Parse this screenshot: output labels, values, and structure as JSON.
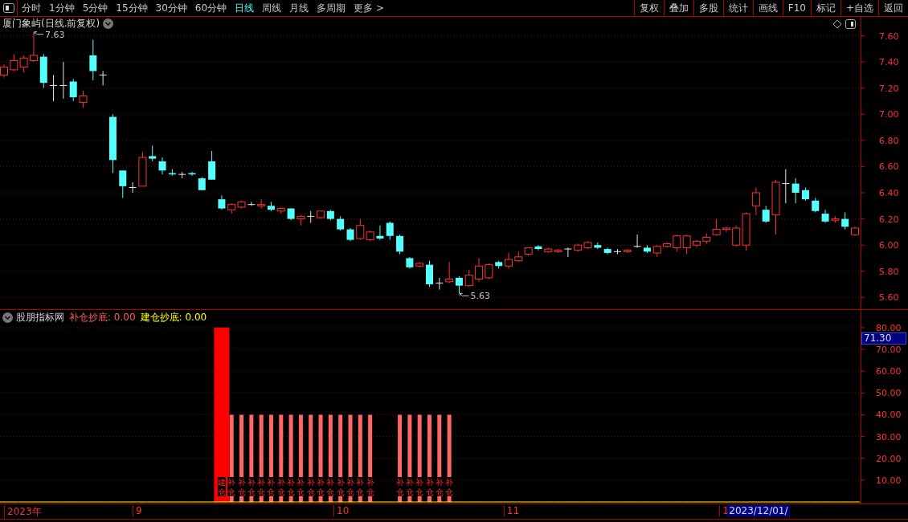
{
  "toolbar": {
    "periods": [
      {
        "label": "分时",
        "selected": false
      },
      {
        "label": "1分钟",
        "selected": false
      },
      {
        "label": "5分钟",
        "selected": false
      },
      {
        "label": "15分钟",
        "selected": false
      },
      {
        "label": "30分钟",
        "selected": false
      },
      {
        "label": "60分钟",
        "selected": false
      },
      {
        "label": "日线",
        "selected": true
      },
      {
        "label": "周线",
        "selected": false
      },
      {
        "label": "月线",
        "selected": false
      },
      {
        "label": "多周期",
        "selected": false
      },
      {
        "label": "更多 >",
        "selected": false
      }
    ],
    "buttons": [
      "复权",
      "叠加",
      "多股",
      "统计",
      "画线",
      "F10",
      "标记",
      "+自选",
      "返回"
    ]
  },
  "main_chart": {
    "title": "厦门象屿(日线.前复权)",
    "chart_data": {
      "type": "candlestick",
      "ylim": [
        5.51,
        7.64
      ],
      "grid": true,
      "yticks": [
        {
          "value": 5.6,
          "label": "5.60"
        },
        {
          "value": 5.8,
          "label": "5.80"
        },
        {
          "value": 6.0,
          "label": "6.00"
        },
        {
          "value": 6.2,
          "label": "6.20"
        },
        {
          "value": 6.4,
          "label": "6.40"
        },
        {
          "value": 6.6,
          "label": "6.60"
        },
        {
          "value": 6.8,
          "label": "6.80"
        },
        {
          "value": 7.0,
          "label": "7.00"
        },
        {
          "value": 7.2,
          "label": "7.20"
        },
        {
          "value": 7.4,
          "label": "7.40"
        },
        {
          "value": 7.6,
          "label": "7.60"
        }
      ],
      "ohlc": [
        [
          7.3,
          7.38,
          7.28,
          7.36
        ],
        [
          7.34,
          7.46,
          7.33,
          7.41
        ],
        [
          7.36,
          7.45,
          7.32,
          7.43
        ],
        [
          7.41,
          7.63,
          7.4,
          7.45
        ],
        [
          7.44,
          7.46,
          7.2,
          7.24
        ],
        [
          7.22,
          7.3,
          7.1,
          7.22
        ],
        [
          7.22,
          7.4,
          7.12,
          7.22
        ],
        [
          7.25,
          7.27,
          7.1,
          7.13
        ],
        [
          7.09,
          7.18,
          7.05,
          7.14
        ],
        [
          7.45,
          7.57,
          7.26,
          7.33
        ],
        [
          7.3,
          7.33,
          7.22,
          7.3
        ],
        [
          6.98,
          7.0,
          6.55,
          6.65
        ],
        [
          6.57,
          6.57,
          6.36,
          6.45
        ],
        [
          6.44,
          6.48,
          6.4,
          6.44
        ],
        [
          6.45,
          6.71,
          6.45,
          6.67
        ],
        [
          6.68,
          6.76,
          6.64,
          6.66
        ],
        [
          6.64,
          6.67,
          6.54,
          6.57
        ],
        [
          6.55,
          6.58,
          6.53,
          6.54
        ],
        [
          6.54,
          6.56,
          6.51,
          6.54
        ],
        [
          6.55,
          6.56,
          6.53,
          6.54
        ],
        [
          6.51,
          6.52,
          6.42,
          6.42
        ],
        [
          6.64,
          6.72,
          6.5,
          6.5
        ],
        [
          6.35,
          6.38,
          6.27,
          6.28
        ],
        [
          6.27,
          6.32,
          6.24,
          6.31
        ],
        [
          6.29,
          6.34,
          6.28,
          6.33
        ],
        [
          6.31,
          6.33,
          6.3,
          6.31
        ],
        [
          6.3,
          6.35,
          6.28,
          6.31
        ],
        [
          6.3,
          6.33,
          6.26,
          6.27
        ],
        [
          6.26,
          6.29,
          6.24,
          6.28
        ],
        [
          6.28,
          6.28,
          6.19,
          6.2
        ],
        [
          6.2,
          6.23,
          6.15,
          6.22
        ],
        [
          6.22,
          6.26,
          6.17,
          6.22
        ],
        [
          6.21,
          6.26,
          6.2,
          6.26
        ],
        [
          6.26,
          6.27,
          6.19,
          6.2
        ],
        [
          6.2,
          6.22,
          6.11,
          6.12
        ],
        [
          6.12,
          6.13,
          6.03,
          6.04
        ],
        [
          6.05,
          6.2,
          6.04,
          6.15
        ],
        [
          6.04,
          6.11,
          6.03,
          6.1
        ],
        [
          6.07,
          6.15,
          6.04,
          6.05
        ],
        [
          6.17,
          6.18,
          6.04,
          6.07
        ],
        [
          6.07,
          6.08,
          5.93,
          5.95
        ],
        [
          5.9,
          5.91,
          5.82,
          5.83
        ],
        [
          5.84,
          5.87,
          5.83,
          5.86
        ],
        [
          5.85,
          5.88,
          5.68,
          5.7
        ],
        [
          5.71,
          5.75,
          5.66,
          5.71
        ],
        [
          5.72,
          5.87,
          5.71,
          5.74
        ],
        [
          5.75,
          5.76,
          5.63,
          5.69
        ],
        [
          5.69,
          5.81,
          5.68,
          5.77
        ],
        [
          5.74,
          5.9,
          5.72,
          5.84
        ],
        [
          5.75,
          5.86,
          5.74,
          5.85
        ],
        [
          5.87,
          5.88,
          5.82,
          5.84
        ],
        [
          5.84,
          5.94,
          5.82,
          5.89
        ],
        [
          5.88,
          5.95,
          5.87,
          5.91
        ],
        [
          5.93,
          5.98,
          5.92,
          5.98
        ],
        [
          5.99,
          6.0,
          5.96,
          5.97
        ],
        [
          5.95,
          5.98,
          5.94,
          5.97
        ],
        [
          5.95,
          5.97,
          5.94,
          5.96
        ],
        [
          5.97,
          5.98,
          5.91,
          5.97
        ],
        [
          5.96,
          6.01,
          5.95,
          6.0
        ],
        [
          5.98,
          6.03,
          5.97,
          6.02
        ],
        [
          6.0,
          6.02,
          5.97,
          5.98
        ],
        [
          5.97,
          5.98,
          5.93,
          5.94
        ],
        [
          5.95,
          5.97,
          5.93,
          5.95
        ],
        [
          5.95,
          5.97,
          5.94,
          5.96
        ],
        [
          5.99,
          6.08,
          5.98,
          5.99
        ],
        [
          5.98,
          6.0,
          5.94,
          5.95
        ],
        [
          5.94,
          6.0,
          5.91,
          5.99
        ],
        [
          5.99,
          6.02,
          5.98,
          6.01
        ],
        [
          5.98,
          6.08,
          5.95,
          6.07
        ],
        [
          5.98,
          6.08,
          5.93,
          6.07
        ],
        [
          6.0,
          6.04,
          5.98,
          6.03
        ],
        [
          6.03,
          6.09,
          6.01,
          6.06
        ],
        [
          6.08,
          6.2,
          6.07,
          6.12
        ],
        [
          6.12,
          6.14,
          6.1,
          6.13
        ],
        [
          6.0,
          6.15,
          5.99,
          6.13
        ],
        [
          6.0,
          6.25,
          5.96,
          6.24
        ],
        [
          6.3,
          6.44,
          6.23,
          6.4
        ],
        [
          6.27,
          6.3,
          6.17,
          6.18
        ],
        [
          6.23,
          6.5,
          6.08,
          6.48
        ],
        [
          6.47,
          6.58,
          6.32,
          6.47
        ],
        [
          6.47,
          6.51,
          6.32,
          6.4
        ],
        [
          6.42,
          6.44,
          6.34,
          6.35
        ],
        [
          6.34,
          6.36,
          6.25,
          6.26
        ],
        [
          6.24,
          6.27,
          6.17,
          6.18
        ],
        [
          6.19,
          6.22,
          6.17,
          6.2
        ],
        [
          6.2,
          6.25,
          6.12,
          6.14
        ],
        [
          6.08,
          6.14,
          6.07,
          6.13
        ]
      ],
      "annotations": [
        "7.63",
        "5.63"
      ]
    }
  },
  "indicator_panel": {
    "name": "股朋指标网",
    "legend": [
      {
        "text": "补仓抄底: 0.00",
        "color": "#ff5a5a"
      },
      {
        "text": "建仓抄底: 0.00",
        "color": "#ffff00"
      }
    ],
    "cursor_value": "71.30",
    "chart_data": {
      "type": "bar",
      "grid": true,
      "ylim": [
        0,
        80.7
      ],
      "yticks": [
        {
          "value": 10,
          "label": "10.00"
        },
        {
          "value": 20,
          "label": "20.00"
        },
        {
          "value": 30,
          "label": "30.00"
        },
        {
          "value": 40,
          "label": "40.00"
        },
        {
          "value": 50,
          "label": "50.00"
        },
        {
          "value": 60,
          "label": "60.00"
        },
        {
          "value": 70,
          "label": "70.00"
        },
        {
          "value": 80,
          "label": "80.00"
        }
      ],
      "series": [
        {
          "color": "#ff0000",
          "values": [
            null,
            null,
            null,
            null,
            null,
            null,
            null,
            null,
            null,
            null,
            null,
            null,
            null,
            null,
            null,
            null,
            null,
            null,
            null,
            null,
            null,
            null,
            80,
            null,
            null,
            null,
            null,
            null,
            null,
            null,
            null,
            null,
            null,
            null,
            null,
            null,
            null,
            null,
            null,
            null,
            null,
            null,
            null,
            null,
            null,
            null,
            null,
            null,
            null,
            null,
            null,
            null,
            null,
            null,
            null,
            null,
            null,
            null,
            null,
            null,
            null,
            null,
            null,
            null,
            null,
            null,
            null,
            null,
            null,
            null,
            null,
            null,
            null,
            null,
            null,
            null,
            null,
            null,
            null,
            null,
            null,
            null,
            null,
            null,
            null,
            null,
            null
          ]
        },
        {
          "color": "#ff6666",
          "values": [
            null,
            null,
            null,
            null,
            null,
            null,
            null,
            null,
            null,
            null,
            null,
            null,
            null,
            null,
            null,
            null,
            null,
            null,
            null,
            null,
            null,
            null,
            null,
            40,
            40,
            40,
            40,
            40,
            40,
            40,
            40,
            40,
            40,
            40,
            40,
            40,
            40,
            40,
            null,
            null,
            40,
            40,
            40,
            40,
            40,
            40,
            null,
            null,
            null,
            null,
            null,
            null,
            null,
            null,
            null,
            null,
            null,
            null,
            null,
            null,
            null,
            null,
            null,
            null,
            null,
            null,
            null,
            null,
            null,
            null,
            null,
            null,
            null,
            null,
            null,
            null,
            null,
            null,
            null,
            null,
            null,
            null,
            null,
            null,
            null,
            null,
            null
          ]
        },
        {
          "color": "#ffff00",
          "values": [
            0,
            0,
            0,
            0,
            0,
            0,
            0,
            0,
            0,
            0,
            0,
            0,
            0,
            0,
            0,
            0,
            0,
            0,
            0,
            0,
            0,
            0,
            0,
            0,
            0,
            0,
            0,
            0,
            0,
            0,
            0,
            0,
            0,
            0,
            0,
            0,
            0,
            0,
            0,
            0,
            0,
            0,
            0,
            0,
            0,
            0,
            0,
            0,
            0,
            0,
            0,
            0,
            0,
            0,
            0,
            0,
            0,
            0,
            0,
            0,
            0,
            0,
            0,
            0,
            0,
            0,
            0,
            0,
            0,
            0,
            0,
            0,
            0,
            0,
            0,
            0,
            0,
            0,
            0,
            0,
            0,
            0,
            0,
            0,
            0,
            0,
            0
          ]
        }
      ],
      "annotations": [
        "建仓",
        "补仓",
        "补仓",
        "补仓",
        "补仓",
        "补仓",
        "补仓",
        "补仓",
        "补仓",
        "补仓",
        "补仓",
        "补仓",
        "补仓",
        "补仓",
        "补仓",
        "补仓",
        "补仓",
        "补仓",
        "补仓",
        "补仓",
        "补仓",
        "补仓"
      ]
    }
  },
  "x_axis": {
    "labels": [
      "2023年",
      "9",
      "10",
      "11",
      "1"
    ],
    "cursor_date": "2023/12/01/"
  }
}
